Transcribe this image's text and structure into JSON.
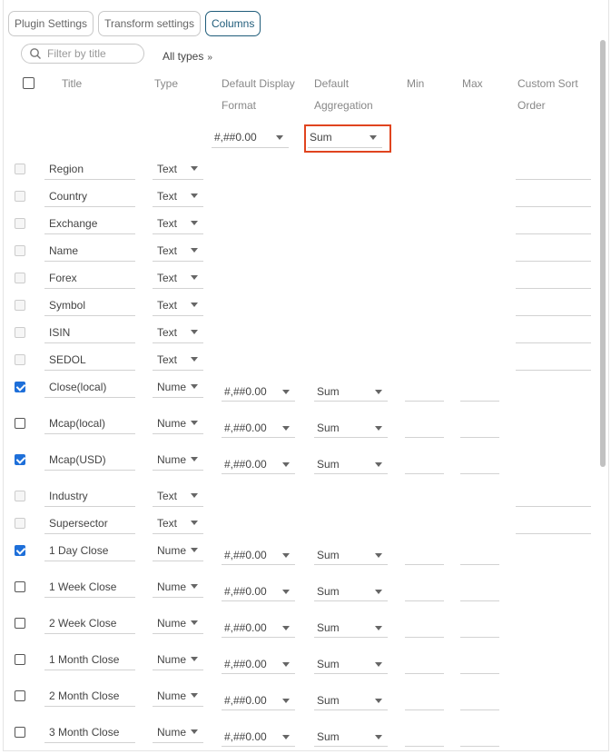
{
  "tabs": [
    {
      "label": "Plugin Settings",
      "active": false
    },
    {
      "label": "Transform settings",
      "active": false
    },
    {
      "label": "Columns",
      "active": true
    }
  ],
  "search": {
    "placeholder": "Filter by title"
  },
  "filter": {
    "label": "All types",
    "icon": "double-chevron-down-icon"
  },
  "headers": {
    "title": "Title",
    "type": "Type",
    "default_display_format_1": "Default Display",
    "default_display_format_2": "Format",
    "default_aggregation_1": "Default",
    "default_aggregation_2": "Aggregation",
    "min": "Min",
    "max": "Max",
    "custom_sort_1": "Custom Sort",
    "custom_sort_2": "Order"
  },
  "defaults": {
    "format": "#,##0.00",
    "aggregation": "Sum"
  },
  "accent": {
    "checked": "#1e6fd9",
    "highlight": "#e0441f",
    "active_tab": "#1f5c7a"
  },
  "rows": [
    {
      "title": "Region",
      "type": "Text",
      "state": "disabled"
    },
    {
      "title": "Country",
      "type": "Text",
      "state": "disabled"
    },
    {
      "title": "Exchange",
      "type": "Text",
      "state": "disabled"
    },
    {
      "title": "Name",
      "type": "Text",
      "state": "disabled"
    },
    {
      "title": "Forex",
      "type": "Text",
      "state": "disabled"
    },
    {
      "title": "Symbol",
      "type": "Text",
      "state": "disabled"
    },
    {
      "title": "ISIN",
      "type": "Text",
      "state": "disabled"
    },
    {
      "title": "SEDOL",
      "type": "Text",
      "state": "disabled"
    },
    {
      "title": "Close(local)",
      "type": "Nume",
      "state": "checked",
      "format": "#,##0.00",
      "aggregation": "Sum"
    },
    {
      "title": "Mcap(local)",
      "type": "Nume",
      "state": "unchecked",
      "format": "#,##0.00",
      "aggregation": "Sum"
    },
    {
      "title": "Mcap(USD)",
      "type": "Nume",
      "state": "checked",
      "format": "#,##0.00",
      "aggregation": "Sum"
    },
    {
      "title": "Industry",
      "type": "Text",
      "state": "disabled"
    },
    {
      "title": "Supersector",
      "type": "Text",
      "state": "disabled"
    },
    {
      "title": "1 Day Close",
      "type": "Nume",
      "state": "checked",
      "format": "#,##0.00",
      "aggregation": "Sum"
    },
    {
      "title": "1 Week Close",
      "type": "Nume",
      "state": "unchecked",
      "format": "#,##0.00",
      "aggregation": "Sum"
    },
    {
      "title": "2 Week Close",
      "type": "Nume",
      "state": "unchecked",
      "format": "#,##0.00",
      "aggregation": "Sum"
    },
    {
      "title": "1 Month Close",
      "type": "Nume",
      "state": "unchecked",
      "format": "#,##0.00",
      "aggregation": "Sum"
    },
    {
      "title": "2 Month Close",
      "type": "Nume",
      "state": "unchecked",
      "format": "#,##0.00",
      "aggregation": "Sum"
    },
    {
      "title": "3 Month Close",
      "type": "Nume",
      "state": "unchecked",
      "format": "#,##0.00",
      "aggregation": "Sum"
    }
  ]
}
